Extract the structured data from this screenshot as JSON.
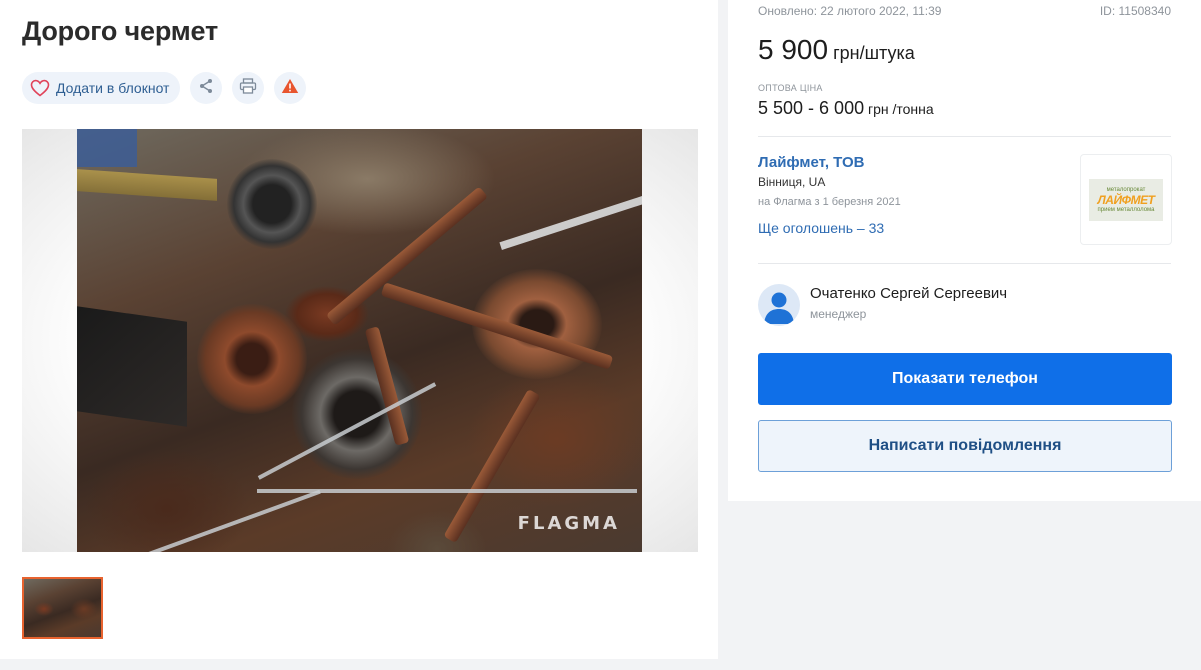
{
  "listing": {
    "title": "Дорого чермет",
    "actions": {
      "notebook_label": "Додати в блокнот",
      "share_icon": "share-icon",
      "print_icon": "print-icon",
      "report_icon": "warning-icon"
    },
    "photo": {
      "watermark": "FLAGMA"
    }
  },
  "sidebar": {
    "updated": "Оновлено: 22 лютого 2022, 11:39",
    "id": "ID: 11508340",
    "price": {
      "value": "5 900",
      "unit": " грн/штука"
    },
    "wholesale": {
      "label": "Оптова ціна",
      "value": "5 500 - 6 000",
      "unit": " грн /тонна"
    },
    "company": {
      "name": "Лайфмет, ТОВ",
      "city": "Вінниця, UA",
      "since": "на Флагма з 1 березня 2021",
      "more_ads": "Ще оголошень – 33",
      "logo": {
        "top": "металопрокат",
        "main": "ЛАЙФМЕТ",
        "bottom": "прием металлолома"
      }
    },
    "manager": {
      "name": "Очатенко Сергей Сергеевич",
      "role": "менеджер"
    },
    "buttons": {
      "phone": "Показати телефон",
      "message": "Написати повідомлення"
    }
  },
  "colors": {
    "accent": "#0f6fe8",
    "link": "#2f6cb3",
    "warning": "#e8552f",
    "thumb_border": "#e8632f"
  }
}
